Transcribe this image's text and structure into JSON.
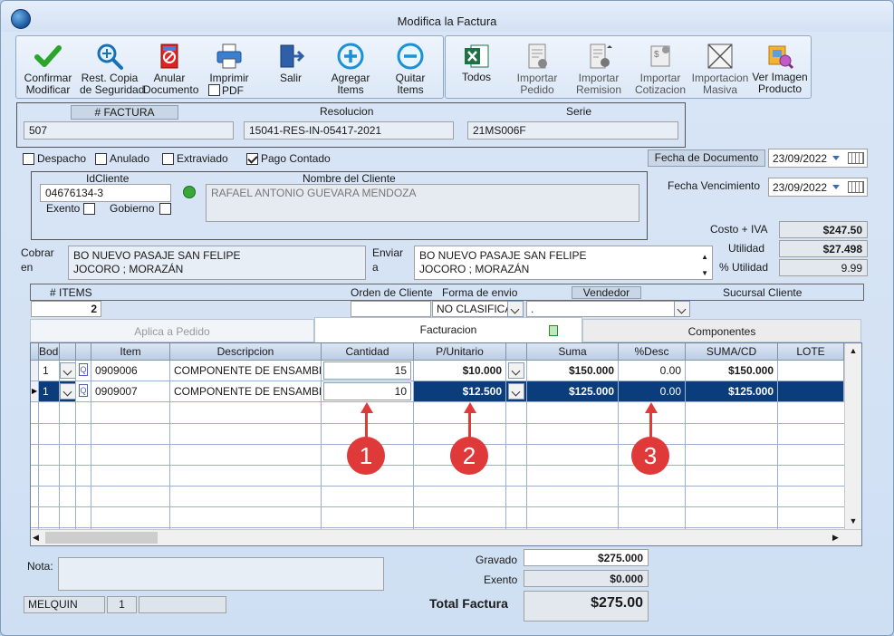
{
  "window": {
    "title": "Modifica la Factura"
  },
  "toolbar": {
    "left": [
      {
        "l1": "Confirmar",
        "l2": "Modificar"
      },
      {
        "l1": "Rest. Copia",
        "l2": "de Seguridad"
      },
      {
        "l1": "Anular",
        "l2": "Documento"
      },
      {
        "l1": "Imprimir",
        "l2": "PDF"
      },
      {
        "l1": "Salir",
        "l2": ""
      },
      {
        "l1": "Agregar",
        "l2": "Items"
      },
      {
        "l1": "Quitar",
        "l2": "Items"
      }
    ],
    "right": [
      {
        "l1": "Todos",
        "l2": ""
      },
      {
        "l1": "Importar",
        "l2": "Pedido"
      },
      {
        "l1": "Importar",
        "l2": "Remision"
      },
      {
        "l1": "Importar",
        "l2": "Cotizacion"
      },
      {
        "l1": "Importacion",
        "l2": "Masiva"
      },
      {
        "l1": "Ver Imagen",
        "l2": "Producto"
      }
    ]
  },
  "invoice": {
    "factura_label": "# FACTURA",
    "factura": "507",
    "resolucion_label": "Resolucion",
    "resolucion": "15041-RES-IN-05417-2021",
    "serie_label": "Serie",
    "serie": "21MS006F"
  },
  "flags": {
    "despacho": "Despacho",
    "anulado": "Anulado",
    "extraviado": "Extraviado",
    "pago_contado": "Pago Contado"
  },
  "dates": {
    "fecha_doc_label": "Fecha de  Documento",
    "fecha_doc": "23/09/2022",
    "fecha_venc_label": "Fecha Vencimiento",
    "fecha_venc": "23/09/2022"
  },
  "client": {
    "id_label": "IdCliente",
    "id": "04676134-3",
    "nombre_label": "Nombre del Cliente",
    "nombre": "RAFAEL ANTONIO GUEVARA MENDOZA",
    "exento": "Exento",
    "gobierno": "Gobierno",
    "cobrar_l1": "Cobrar",
    "cobrar_l2": "en",
    "cobrar_1": "BO NUEVO PASAJE SAN FELIPE",
    "cobrar_2": "JOCORO ; MORAZÁN",
    "enviar_l1": "Enviar",
    "enviar_l2": "a",
    "enviar_1": "BO NUEVO PASAJE SAN FELIPE",
    "enviar_2": "JOCORO ; MORAZÁN"
  },
  "costs": {
    "costo_label": "Costo + IVA",
    "costo": "$247.50",
    "utilidad_label": "Utilidad",
    "utilidad": "$27.498",
    "putil_label": "% Utilidad",
    "putil": "9.99"
  },
  "info": {
    "items_label": "# ITEMS",
    "items": "2",
    "orden_label": "Orden de Cliente",
    "forma_label": "Forma de envio",
    "forma": "NO CLASIFICA",
    "vendedor_label": "Vendedor",
    "vendedor": ".",
    "sucursal_label": "Sucursal Cliente"
  },
  "tabs": {
    "t1": "Aplica a Pedido",
    "t2": "Facturacion",
    "t3": "Componentes"
  },
  "grid": {
    "headers": [
      "Bodega",
      "",
      "",
      "Item",
      "Descripcion",
      "Cantidad",
      "P/Unitario",
      "",
      "Suma",
      "%Desc",
      "SUMA/CD",
      "LOTE"
    ],
    "rows": [
      {
        "bodega": "1",
        "item": "0909006",
        "desc": "COMPONENTE DE ENSAMBLE",
        "cant": "15",
        "pu": "$10.000",
        "suma": "$150.000",
        "desc_pct": "0.00",
        "sumacd": "$150.000"
      },
      {
        "bodega": "1",
        "item": "0909007",
        "desc": "COMPONENTE DE ENSAMBLE",
        "cant": "10",
        "pu": "$12.500",
        "suma": "$125.000",
        "desc_pct": "0.00",
        "sumacd": "$125.000"
      }
    ]
  },
  "callouts": [
    "1",
    "2",
    "3"
  ],
  "footer": {
    "nota_label": "Nota:",
    "user": "MELQUIN",
    "user_num": "1",
    "gravado_label": "Gravado",
    "gravado": "$275.000",
    "exento_label": "Exento",
    "exento": "$0.000",
    "total_label": "Total Factura",
    "total": "$275.00"
  }
}
